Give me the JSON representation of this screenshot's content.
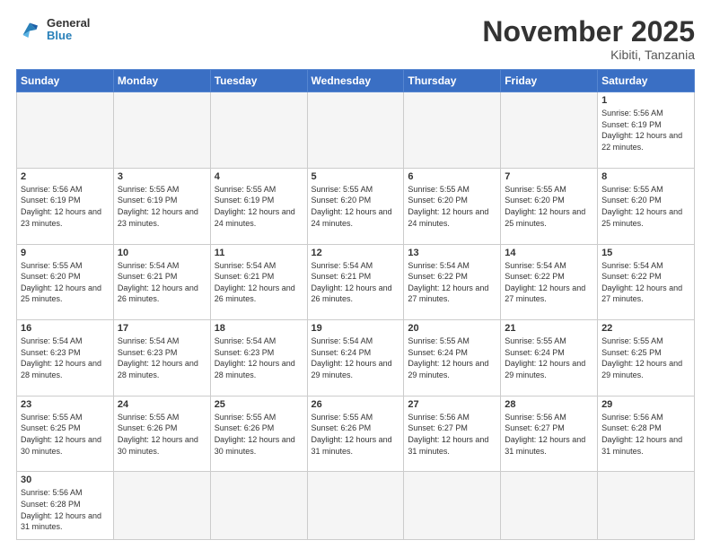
{
  "header": {
    "logo_general": "General",
    "logo_blue": "Blue",
    "month_title": "November 2025",
    "location": "Kibiti, Tanzania"
  },
  "weekdays": [
    "Sunday",
    "Monday",
    "Tuesday",
    "Wednesday",
    "Thursday",
    "Friday",
    "Saturday"
  ],
  "weeks": [
    [
      {
        "day": "",
        "info": ""
      },
      {
        "day": "",
        "info": ""
      },
      {
        "day": "",
        "info": ""
      },
      {
        "day": "",
        "info": ""
      },
      {
        "day": "",
        "info": ""
      },
      {
        "day": "",
        "info": ""
      },
      {
        "day": "1",
        "info": "Sunrise: 5:56 AM\nSunset: 6:19 PM\nDaylight: 12 hours and 22 minutes."
      }
    ],
    [
      {
        "day": "2",
        "info": "Sunrise: 5:56 AM\nSunset: 6:19 PM\nDaylight: 12 hours and 23 minutes."
      },
      {
        "day": "3",
        "info": "Sunrise: 5:55 AM\nSunset: 6:19 PM\nDaylight: 12 hours and 23 minutes."
      },
      {
        "day": "4",
        "info": "Sunrise: 5:55 AM\nSunset: 6:19 PM\nDaylight: 12 hours and 24 minutes."
      },
      {
        "day": "5",
        "info": "Sunrise: 5:55 AM\nSunset: 6:20 PM\nDaylight: 12 hours and 24 minutes."
      },
      {
        "day": "6",
        "info": "Sunrise: 5:55 AM\nSunset: 6:20 PM\nDaylight: 12 hours and 24 minutes."
      },
      {
        "day": "7",
        "info": "Sunrise: 5:55 AM\nSunset: 6:20 PM\nDaylight: 12 hours and 25 minutes."
      },
      {
        "day": "8",
        "info": "Sunrise: 5:55 AM\nSunset: 6:20 PM\nDaylight: 12 hours and 25 minutes."
      }
    ],
    [
      {
        "day": "9",
        "info": "Sunrise: 5:55 AM\nSunset: 6:20 PM\nDaylight: 12 hours and 25 minutes."
      },
      {
        "day": "10",
        "info": "Sunrise: 5:54 AM\nSunset: 6:21 PM\nDaylight: 12 hours and 26 minutes."
      },
      {
        "day": "11",
        "info": "Sunrise: 5:54 AM\nSunset: 6:21 PM\nDaylight: 12 hours and 26 minutes."
      },
      {
        "day": "12",
        "info": "Sunrise: 5:54 AM\nSunset: 6:21 PM\nDaylight: 12 hours and 26 minutes."
      },
      {
        "day": "13",
        "info": "Sunrise: 5:54 AM\nSunset: 6:22 PM\nDaylight: 12 hours and 27 minutes."
      },
      {
        "day": "14",
        "info": "Sunrise: 5:54 AM\nSunset: 6:22 PM\nDaylight: 12 hours and 27 minutes."
      },
      {
        "day": "15",
        "info": "Sunrise: 5:54 AM\nSunset: 6:22 PM\nDaylight: 12 hours and 27 minutes."
      }
    ],
    [
      {
        "day": "16",
        "info": "Sunrise: 5:54 AM\nSunset: 6:23 PM\nDaylight: 12 hours and 28 minutes."
      },
      {
        "day": "17",
        "info": "Sunrise: 5:54 AM\nSunset: 6:23 PM\nDaylight: 12 hours and 28 minutes."
      },
      {
        "day": "18",
        "info": "Sunrise: 5:54 AM\nSunset: 6:23 PM\nDaylight: 12 hours and 28 minutes."
      },
      {
        "day": "19",
        "info": "Sunrise: 5:54 AM\nSunset: 6:24 PM\nDaylight: 12 hours and 29 minutes."
      },
      {
        "day": "20",
        "info": "Sunrise: 5:55 AM\nSunset: 6:24 PM\nDaylight: 12 hours and 29 minutes."
      },
      {
        "day": "21",
        "info": "Sunrise: 5:55 AM\nSunset: 6:24 PM\nDaylight: 12 hours and 29 minutes."
      },
      {
        "day": "22",
        "info": "Sunrise: 5:55 AM\nSunset: 6:25 PM\nDaylight: 12 hours and 29 minutes."
      }
    ],
    [
      {
        "day": "23",
        "info": "Sunrise: 5:55 AM\nSunset: 6:25 PM\nDaylight: 12 hours and 30 minutes."
      },
      {
        "day": "24",
        "info": "Sunrise: 5:55 AM\nSunset: 6:26 PM\nDaylight: 12 hours and 30 minutes."
      },
      {
        "day": "25",
        "info": "Sunrise: 5:55 AM\nSunset: 6:26 PM\nDaylight: 12 hours and 30 minutes."
      },
      {
        "day": "26",
        "info": "Sunrise: 5:55 AM\nSunset: 6:26 PM\nDaylight: 12 hours and 31 minutes."
      },
      {
        "day": "27",
        "info": "Sunrise: 5:56 AM\nSunset: 6:27 PM\nDaylight: 12 hours and 31 minutes."
      },
      {
        "day": "28",
        "info": "Sunrise: 5:56 AM\nSunset: 6:27 PM\nDaylight: 12 hours and 31 minutes."
      },
      {
        "day": "29",
        "info": "Sunrise: 5:56 AM\nSunset: 6:28 PM\nDaylight: 12 hours and 31 minutes."
      }
    ],
    [
      {
        "day": "30",
        "info": "Sunrise: 5:56 AM\nSunset: 6:28 PM\nDaylight: 12 hours and 31 minutes."
      },
      {
        "day": "",
        "info": ""
      },
      {
        "day": "",
        "info": ""
      },
      {
        "day": "",
        "info": ""
      },
      {
        "day": "",
        "info": ""
      },
      {
        "day": "",
        "info": ""
      },
      {
        "day": "",
        "info": ""
      }
    ]
  ]
}
